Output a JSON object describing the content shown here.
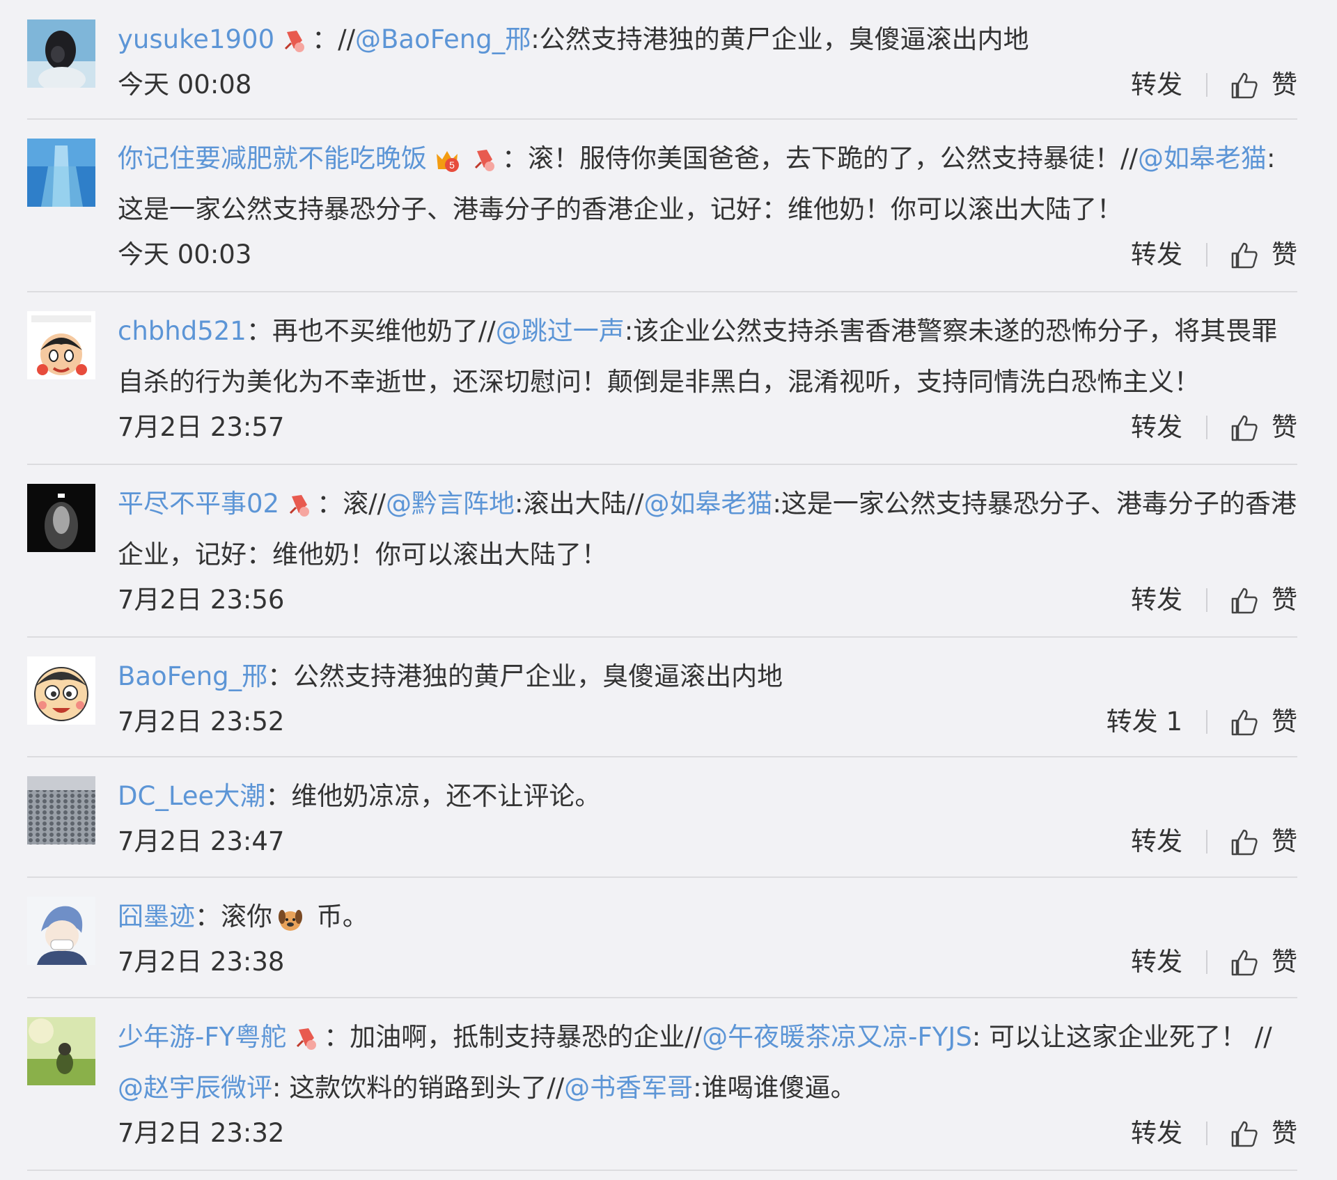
{
  "labels": {
    "repost": "转发",
    "like": "赞"
  },
  "colors": {
    "link": "#5c95d6",
    "text": "#333333",
    "background": "#f2f2f5",
    "divider": "#dcdcdf"
  },
  "comments": [
    {
      "user": "yusuke1900",
      "badge": "collector-badge-icon",
      "sep": "：",
      "segments": [
        {
          "t": "plain",
          "v": "//"
        },
        {
          "t": "mention",
          "v": "@BaoFeng_邢"
        },
        {
          "t": "plain",
          "v": ":公然支持港独的黄尸企业，臭傻逼滚出内地"
        }
      ],
      "time": "今天 00:08",
      "repost_label": "转发",
      "like_label": "赞"
    },
    {
      "user": "你记住要减肥就不能吃晚饭",
      "badge": "vip-level-5-badge-icon",
      "sep": "：",
      "segments": [
        {
          "t": "plain",
          "v": "滚！服侍你美国爸爸，去下跪的了，公然支持暴徒！//"
        },
        {
          "t": "mention",
          "v": "@如皋老猫"
        },
        {
          "t": "plain",
          "v": ":这是一家公然支持暴恐分子、港毒分子的香港企业，记好：维他奶！你可以滚出大陆了！"
        }
      ],
      "time": "今天 00:03",
      "repost_label": "转发",
      "like_label": "赞"
    },
    {
      "user": "chbhd521",
      "badge": "",
      "sep": "：",
      "segments": [
        {
          "t": "plain",
          "v": "再也不买维他奶了//"
        },
        {
          "t": "mention",
          "v": "@跳过一声"
        },
        {
          "t": "plain",
          "v": ":该企业公然支持杀害香港警察未遂的恐怖分子，将其畏罪自杀的行为美化为不幸逝世，还深切慰问！颠倒是非黑白，混淆视听，支持同情洗白恐怖主义！"
        }
      ],
      "time": "7月2日 23:57",
      "repost_label": "转发",
      "like_label": "赞"
    },
    {
      "user": "平尽不平事02",
      "badge": "collector-badge-icon",
      "sep": "：",
      "segments": [
        {
          "t": "plain",
          "v": "滚//"
        },
        {
          "t": "mention",
          "v": "@黔言阵地"
        },
        {
          "t": "plain",
          "v": ":滚出大陆//"
        },
        {
          "t": "mention",
          "v": "@如皋老猫"
        },
        {
          "t": "plain",
          "v": ":这是一家公然支持暴恐分子、港毒分子的香港企业，记好：维他奶！你可以滚出大陆了！"
        }
      ],
      "time": "7月2日 23:56",
      "repost_label": "转发",
      "like_label": "赞"
    },
    {
      "user": "BaoFeng_邢",
      "badge": "",
      "sep": "：",
      "segments": [
        {
          "t": "plain",
          "v": "公然支持港独的黄尸企业，臭傻逼滚出内地"
        }
      ],
      "time": "7月2日 23:52",
      "repost_label": "转发 1",
      "like_label": "赞"
    },
    {
      "user": "DC_Lee大潮",
      "badge": "",
      "sep": "：",
      "segments": [
        {
          "t": "plain",
          "v": "维他奶凉凉，还不让评论。"
        }
      ],
      "time": "7月2日 23:47",
      "repost_label": "转发",
      "like_label": "赞"
    },
    {
      "user": "囧墨迹",
      "badge": "",
      "sep": "：",
      "segments": [
        {
          "t": "plain",
          "v": "滚你"
        },
        {
          "t": "emoji",
          "v": "dog-emoji-icon"
        },
        {
          "t": "plain",
          "v": " 币。"
        }
      ],
      "time": "7月2日 23:38",
      "repost_label": "转发",
      "like_label": "赞"
    },
    {
      "user": "少年游-FY粤舵",
      "badge": "collector-badge-icon",
      "sep": "：",
      "segments": [
        {
          "t": "plain",
          "v": "加油啊，抵制支持暴恐的企业//"
        },
        {
          "t": "mention",
          "v": "@午夜暖茶凉又凉-FYJS"
        },
        {
          "t": "plain",
          "v": ": 可以让这家企业死了！ //"
        },
        {
          "t": "mention",
          "v": "@赵宇辰微评"
        },
        {
          "t": "plain",
          "v": ": 这款饮料的销路到头了//"
        },
        {
          "t": "mention",
          "v": "@书香军哥"
        },
        {
          "t": "plain",
          "v": ":谁喝谁傻逼。"
        }
      ],
      "time": "7月2日 23:32",
      "repost_label": "转发",
      "like_label": "赞"
    }
  ]
}
